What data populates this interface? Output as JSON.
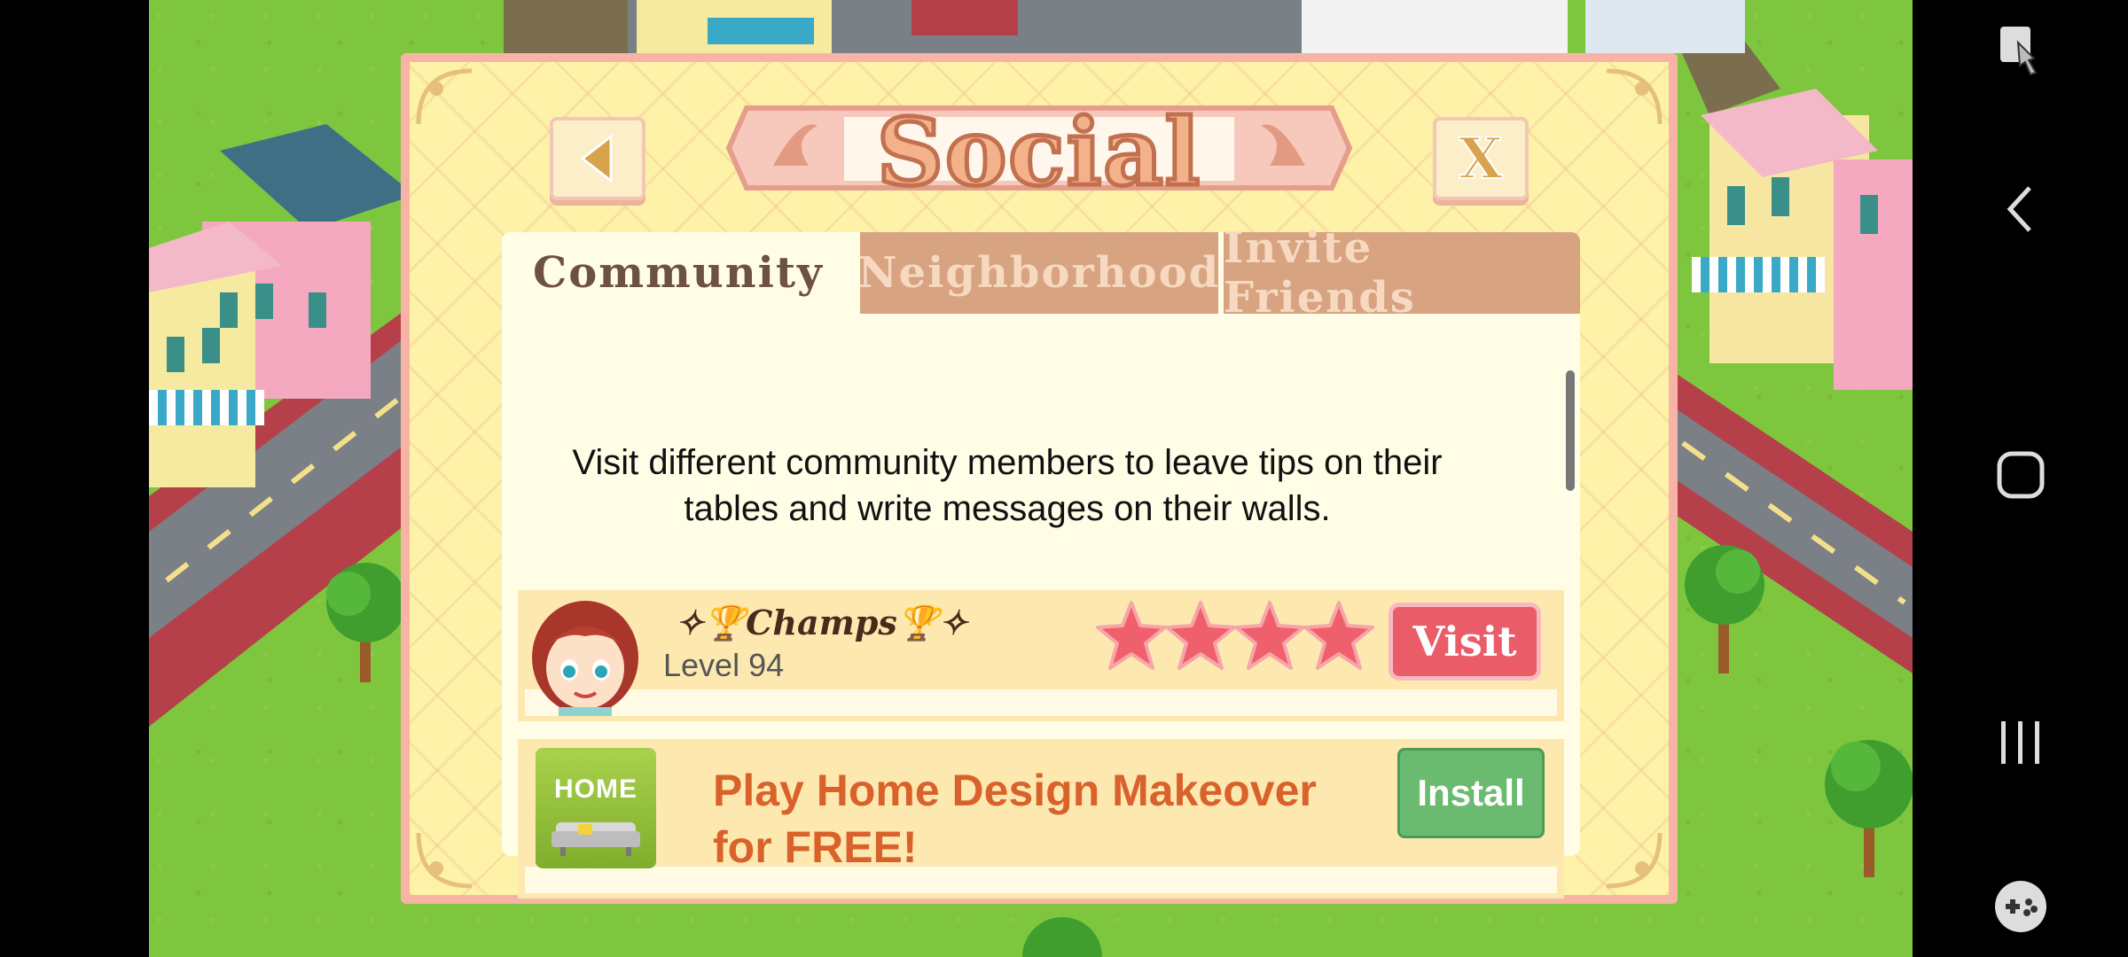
{
  "dialog": {
    "title": "Social",
    "close_label": "X",
    "tabs": [
      {
        "label": "Community",
        "active": true
      },
      {
        "label": "Neighborhood",
        "active": false
      },
      {
        "label": "Invite Friends",
        "active": false
      }
    ],
    "description": "Visit different community members to leave tips on their tables and write messages on their walls.",
    "member": {
      "name": "✧🏆𝑪𝒉𝒂𝒎𝒑𝒔🏆✧",
      "level": "Level 94",
      "stars": 4,
      "visit_label": "Visit"
    },
    "ad": {
      "icon_text": "HOME",
      "text": "Play Home Design Makeover for FREE!",
      "install_label": "Install"
    }
  },
  "colors": {
    "grass": "#7fc63f",
    "panel": "#fffde6",
    "tab_inactive": "#d8a381",
    "visit": "#e95c68",
    "install": "#6abb6f",
    "ad_text": "#d9622c"
  },
  "nav_icons": [
    "accessibility-icon",
    "back-icon",
    "home-icon",
    "recents-icon",
    "game-tools-icon"
  ]
}
